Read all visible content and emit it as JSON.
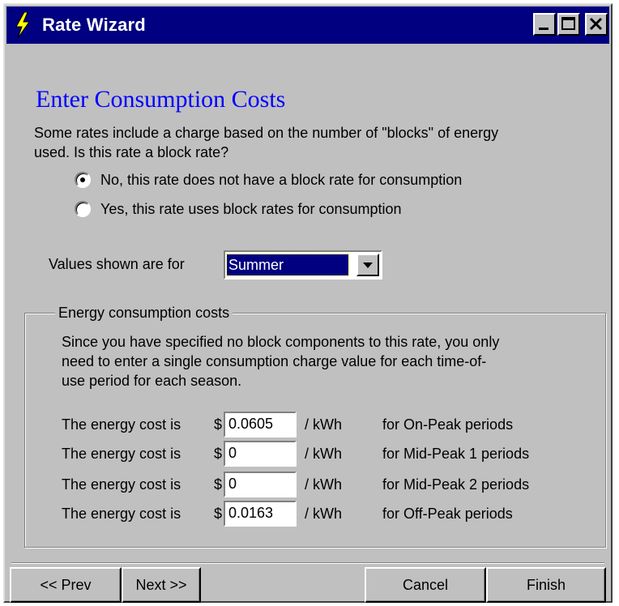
{
  "window": {
    "title": "Rate Wizard",
    "icon": "lightning-bolt-icon",
    "controls": [
      "minimize-icon",
      "maximize-icon",
      "close-icon"
    ]
  },
  "page": {
    "heading": "Enter Consumption Costs",
    "intro_line1": "Some rates include a charge based on the number of \"blocks\" of energy",
    "intro_line2": "used.  Is this rate a block rate?"
  },
  "block_rate": {
    "selected": "no",
    "options": [
      {
        "id": "no",
        "label": "No, this rate does not have a block rate for consumption"
      },
      {
        "id": "yes",
        "label": "Yes, this rate uses block rates for consumption"
      }
    ]
  },
  "season": {
    "label": "Values shown are for",
    "selected": "Summer"
  },
  "group": {
    "title": "Energy consumption costs",
    "desc_line1": "Since you have specified no block components to this rate, you only",
    "desc_line2": "need to enter a single consumption charge value for each time-of-",
    "desc_line3": "use period for each season.",
    "rows": [
      {
        "prefix": "The energy cost is",
        "currency": "$",
        "value": "0.0605",
        "unit": "/ kWh",
        "period": "for On-Peak periods"
      },
      {
        "prefix": "The energy cost is",
        "currency": "$",
        "value": "0",
        "unit": "/ kWh",
        "period": "for Mid-Peak 1 periods"
      },
      {
        "prefix": "The energy cost is",
        "currency": "$",
        "value": "0",
        "unit": "/ kWh",
        "period": "for Mid-Peak 2 periods"
      },
      {
        "prefix": "The energy cost is",
        "currency": "$",
        "value": "0.0163",
        "unit": "/ kWh",
        "period": "for Off-Peak periods"
      }
    ]
  },
  "buttons": {
    "prev": "<< Prev",
    "next": "Next >>",
    "cancel": "Cancel",
    "finish": "Finish"
  },
  "colors": {
    "titlebar": "#000080",
    "heading": "#0000ff",
    "face": "#c0c0c0"
  }
}
